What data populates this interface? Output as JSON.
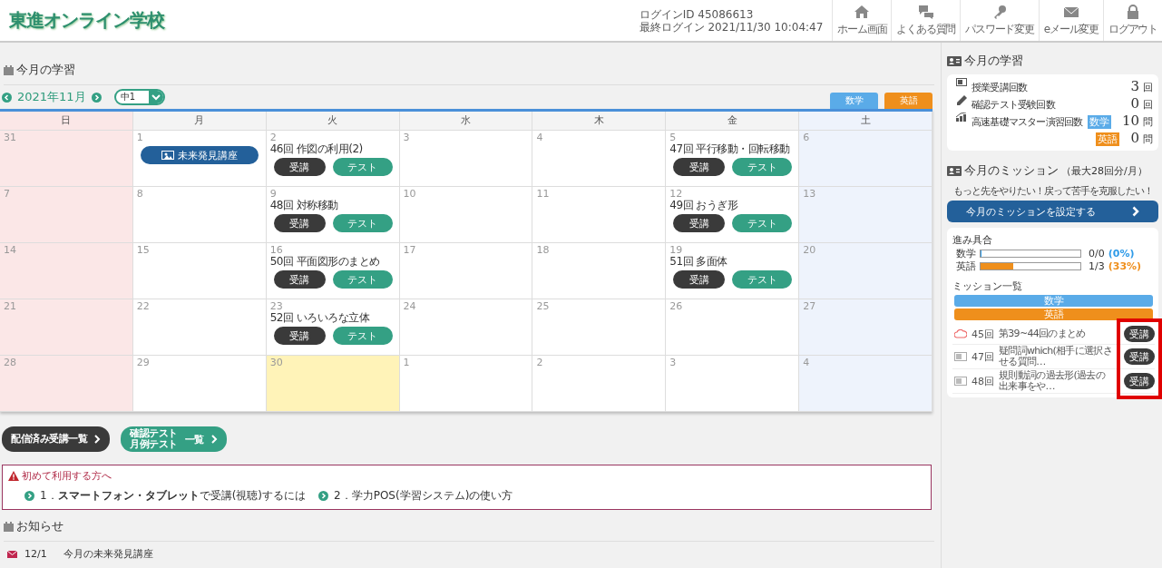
{
  "header": {
    "logo": "東進オンライン学校",
    "login_id": "ログインID 45086613",
    "last_login": "最終ログイン 2021/11/30 10:04:47",
    "nav": [
      {
        "kind": "home",
        "label": "ホーム画面"
      },
      {
        "kind": "faq",
        "label": "よくある質問"
      },
      {
        "kind": "password",
        "label": "パスワード変更"
      },
      {
        "kind": "mail",
        "label": "eメール変更"
      },
      {
        "kind": "logout",
        "label": "ログアウト"
      }
    ]
  },
  "study": {
    "title": "今月の学習",
    "month": "2021年11月",
    "grade": "中1",
    "subjects": [
      {
        "label": "数学",
        "color": "#5aabe8"
      },
      {
        "label": "英語",
        "color": "#ef8f1c"
      }
    ],
    "weekdays": [
      "日",
      "月",
      "火",
      "水",
      "木",
      "金",
      "土"
    ],
    "weeks": [
      [
        {
          "day": "31",
          "today": false
        },
        {
          "day": "1",
          "today": false,
          "events": [
            {
              "kind": "banner",
              "label": "未来発見講座"
            }
          ]
        },
        {
          "day": "2",
          "today": false,
          "events": [
            {
              "kind": "lesson",
              "title": "46回 作図の利用(2)",
              "watch": "受講",
              "test": "テスト"
            }
          ]
        },
        {
          "day": "3",
          "today": false
        },
        {
          "day": "4",
          "today": false
        },
        {
          "day": "5",
          "today": false,
          "events": [
            {
              "kind": "lesson",
              "title": "47回 平行移動・回転移動",
              "watch": "受講",
              "test": "テスト"
            }
          ]
        },
        {
          "day": "6",
          "today": false
        }
      ],
      [
        {
          "day": "7",
          "today": false
        },
        {
          "day": "8",
          "today": false
        },
        {
          "day": "9",
          "today": false,
          "events": [
            {
              "kind": "lesson",
              "title": "48回 対称移動",
              "watch": "受講",
              "test": "テスト"
            }
          ]
        },
        {
          "day": "10",
          "today": false
        },
        {
          "day": "11",
          "today": false
        },
        {
          "day": "12",
          "today": false,
          "events": [
            {
              "kind": "lesson",
              "title": "49回 おうぎ形",
              "watch": "受講",
              "test": "テスト"
            }
          ]
        },
        {
          "day": "13",
          "today": false
        }
      ],
      [
        {
          "day": "14",
          "today": false
        },
        {
          "day": "15",
          "today": false
        },
        {
          "day": "16",
          "today": false,
          "events": [
            {
              "kind": "lesson",
              "title": "50回 平面図形のまとめ",
              "watch": "受講",
              "test": "テスト"
            }
          ]
        },
        {
          "day": "17",
          "today": false
        },
        {
          "day": "18",
          "today": false
        },
        {
          "day": "19",
          "today": false,
          "events": [
            {
              "kind": "lesson",
              "title": "51回 多面体",
              "watch": "受講",
              "test": "テスト"
            }
          ]
        },
        {
          "day": "20",
          "today": false
        }
      ],
      [
        {
          "day": "21",
          "today": false
        },
        {
          "day": "22",
          "today": false
        },
        {
          "day": "23",
          "today": false,
          "events": [
            {
              "kind": "lesson",
              "title": "52回 いろいろな立体",
              "watch": "受講",
              "test": "テスト"
            }
          ]
        },
        {
          "day": "24",
          "today": false
        },
        {
          "day": "25",
          "today": false
        },
        {
          "day": "26",
          "today": false
        },
        {
          "day": "27",
          "today": false
        }
      ],
      [
        {
          "day": "28",
          "today": false
        },
        {
          "day": "29",
          "today": false
        },
        {
          "day": "30",
          "today": true
        },
        {
          "day": "1",
          "today": false
        },
        {
          "day": "2",
          "today": false
        },
        {
          "day": "3",
          "today": false
        },
        {
          "day": "4",
          "today": false
        }
      ]
    ],
    "links": [
      {
        "kind": "dark",
        "lines": [
          "配信済み受講一覧"
        ]
      },
      {
        "kind": "green",
        "lines": [
          "確認テスト",
          "月例テスト"
        ],
        "suffix": "一覧"
      }
    ]
  },
  "notice": {
    "title": "初めて利用する方へ",
    "items": [
      "1．**スマートフォン・タブレット**で受講(視聴)するには",
      "2．学力POS(学習システム)の使い方"
    ]
  },
  "news": {
    "title": "お知らせ",
    "items": [
      {
        "date": "12/1",
        "text": "今月の未来発見講座"
      }
    ]
  },
  "sidebar": {
    "summary": {
      "title": "今月の学習",
      "rows": [
        {
          "kind": "video",
          "label": "授業受講回数",
          "entries": [
            {
              "value": "3",
              "unit": "回"
            }
          ]
        },
        {
          "kind": "pencil",
          "label": "確認テスト受験回数",
          "entries": [
            {
              "value": "0",
              "unit": "回"
            }
          ]
        },
        {
          "kind": "chart",
          "label": "高速基礎マスター演習回数",
          "entries": [
            {
              "tag": "数学",
              "color": "#5aabe8",
              "value": "10",
              "unit": "問"
            },
            {
              "tag": "英語",
              "color": "#ef8f1c",
              "value": "0",
              "unit": "問"
            }
          ]
        }
      ]
    },
    "mission": {
      "title": "今月のミッション",
      "limit": "（最大28回分/月）",
      "lead": "もっと先をやりたい！戻って苦手を克服したい！",
      "button": "今月のミッションを設定する",
      "progress_title": "進み具合",
      "progress": [
        {
          "subject": "数学",
          "level": 0,
          "reading": "0/0",
          "percent": "(0%)",
          "color": "#2f9be8"
        },
        {
          "subject": "英語",
          "level": 0.33,
          "reading": "1/3",
          "percent": "(33%)",
          "color": "#ef8f1c"
        }
      ],
      "list_title": "ミッション一覧",
      "subjects": [
        {
          "label": "数学",
          "color": "#5aabe8"
        },
        {
          "label": "英語",
          "color": "#ef8f1c"
        }
      ],
      "highlighted": true,
      "items": [
        {
          "kind": "cloud",
          "number": "45回",
          "title": "第39~44回のまとめ",
          "button": "受講"
        },
        {
          "kind": "video",
          "number": "47回",
          "title": "疑問詞which(相手に選択させる質問…",
          "button": "受講"
        },
        {
          "kind": "video",
          "number": "48回",
          "title": "規則動詞の過去形(過去の出来事をや…",
          "button": "受講"
        }
      ]
    }
  }
}
